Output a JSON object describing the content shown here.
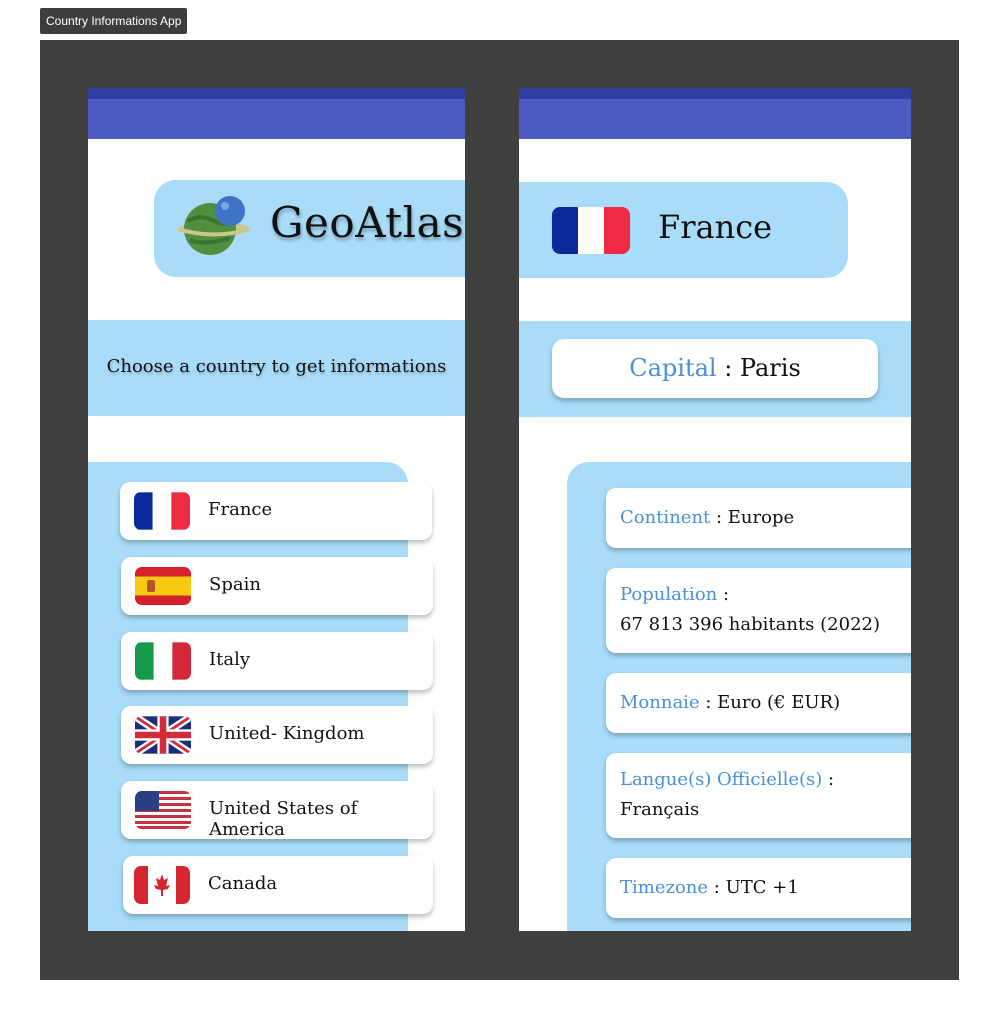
{
  "frame": {
    "title": "Country Informations App"
  },
  "home": {
    "logo_title": "GeoAtlas",
    "prompt": "Choose a country to get informations",
    "countries": [
      {
        "name": "France",
        "flag_icon": "france-flag-icon"
      },
      {
        "name": "Spain",
        "flag_icon": "spain-flag-icon"
      },
      {
        "name": "Italy",
        "flag_icon": "italy-flag-icon"
      },
      {
        "name": "United- Kingdom",
        "flag_icon": "united-kingdom-flag-icon"
      },
      {
        "name": "United States of America",
        "flag_icon": "usa-flag-icon"
      },
      {
        "name": "Canada",
        "flag_icon": "canada-flag-icon"
      }
    ]
  },
  "detail": {
    "country_name": "France",
    "capital": {
      "label": "Capital",
      "sep": " : ",
      "value": "Paris"
    },
    "info": {
      "continent": {
        "label": "Continent",
        "sep": " : ",
        "value": "Europe"
      },
      "population": {
        "label": "Population",
        "sep": " :",
        "value": "67 813 396 habitants (2022)"
      },
      "currency": {
        "label": "Monnaie",
        "sep": " : ",
        "value": "Euro (€ EUR)"
      },
      "languages": {
        "label": "Langue(s) Officielle(s)",
        "sep": " :",
        "value": "Français"
      },
      "timezone": {
        "label": "Timezone",
        "sep": " : ",
        "value": "UTC +1"
      }
    }
  },
  "colors": {
    "canvas": "#404040",
    "status_bar": "#303f9f",
    "app_bar": "#4f5bc4",
    "panel": "#a8dcf9",
    "label_accent": "#4a90d6"
  }
}
